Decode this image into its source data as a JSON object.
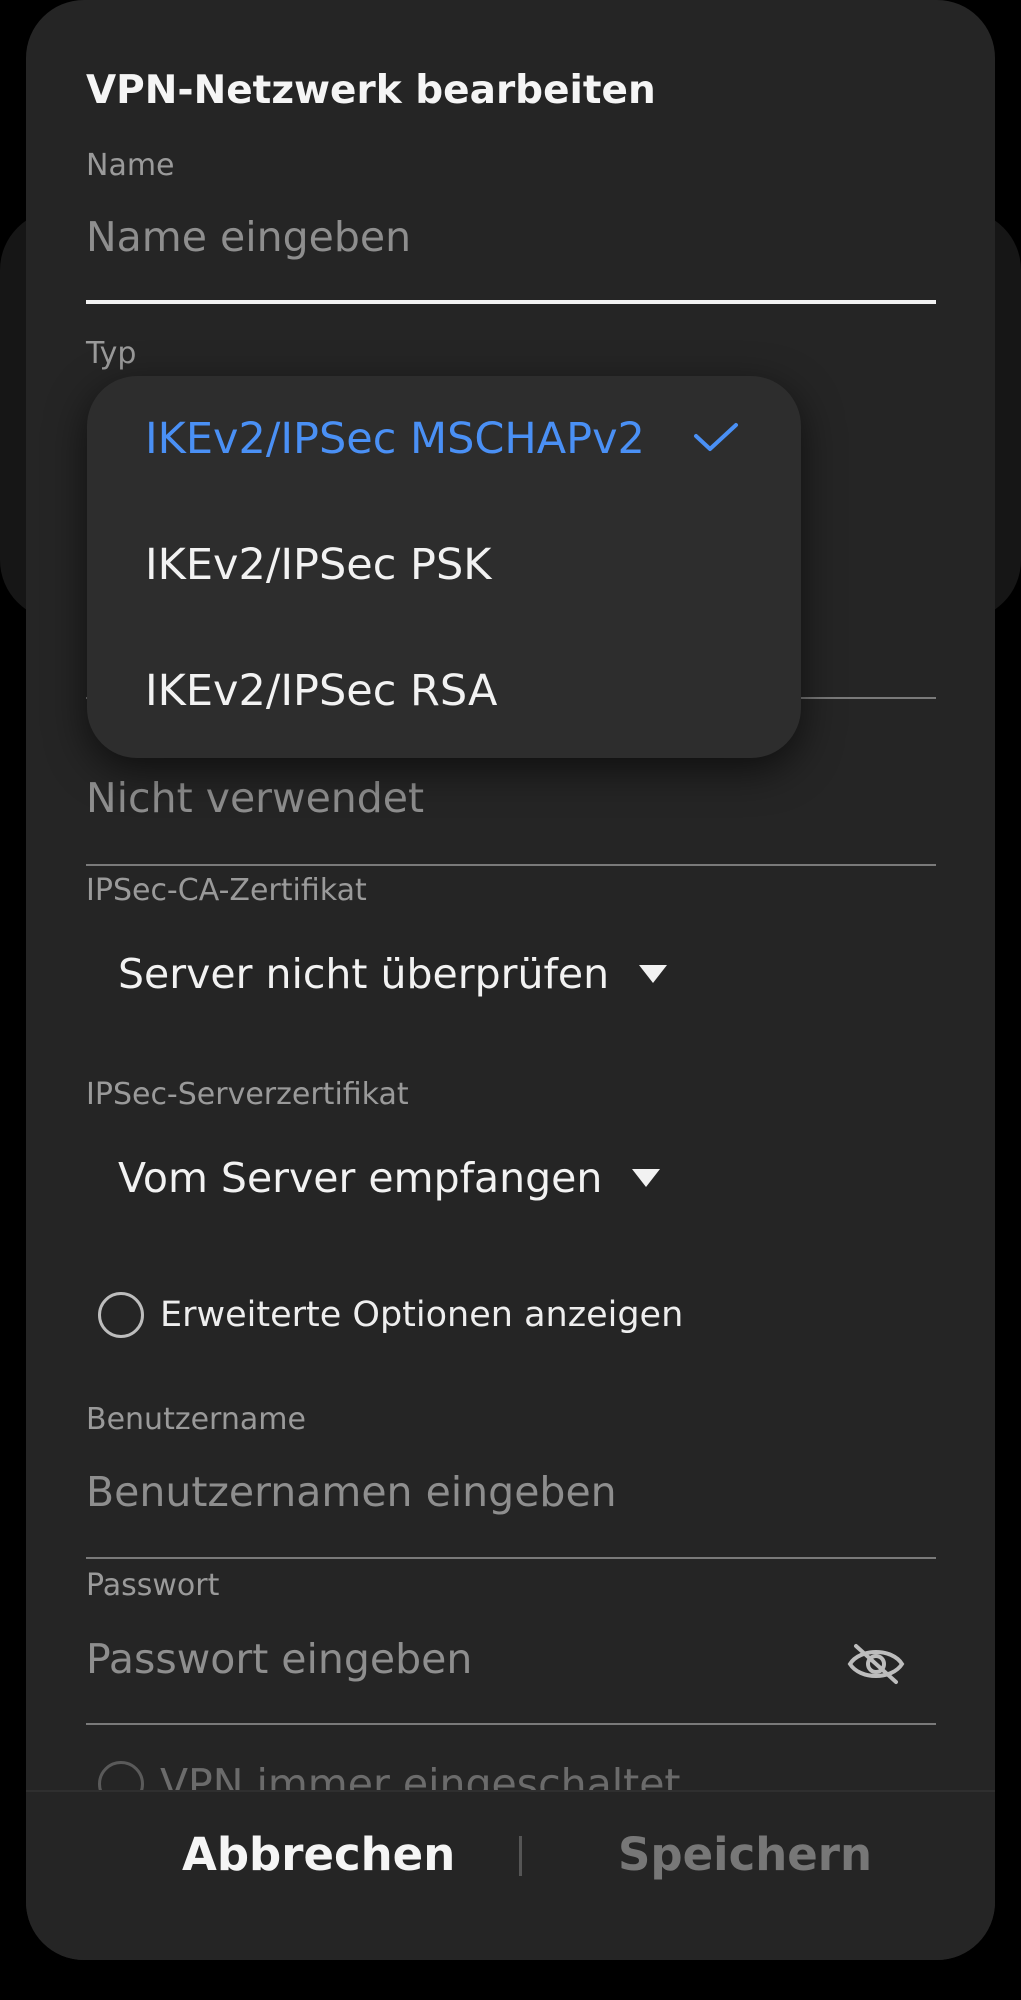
{
  "dialog": {
    "title": "VPN-Netzwerk bearbeiten",
    "name_label": "Name",
    "name_placeholder": "Name eingeben",
    "type_label": "Typ",
    "identifier_placeholder": "Nicht verwendet",
    "ca_cert_label": "IPSec-CA-Zertifikat",
    "ca_cert_value": "Server nicht überprüfen",
    "server_cert_label": "IPSec-Serverzertifikat",
    "server_cert_value": "Vom Server empfangen",
    "advanced_options_label": "Erweiterte Optionen anzeigen",
    "username_label": "Benutzername",
    "username_placeholder": "Benutzernamen eingeben",
    "password_label": "Passwort",
    "password_placeholder": "Passwort eingeben",
    "always_on_label": "VPN immer eingeschaltet",
    "cancel_label": "Abbrechen",
    "save_label": "Speichern"
  },
  "type_dropdown": {
    "options": [
      {
        "label": "IKEv2/IPSec MSCHAPv2",
        "selected": true
      },
      {
        "label": "IKEv2/IPSec PSK",
        "selected": false
      },
      {
        "label": "IKEv2/IPSec RSA",
        "selected": false
      }
    ]
  },
  "colors": {
    "accent": "#4a90f5",
    "dialog_bg": "#252525",
    "menu_bg": "#2d2d2d",
    "text_primary": "#f2f2f2",
    "text_secondary": "#9a9a9a",
    "disabled": "#777777"
  },
  "icons": {
    "check": "check-icon",
    "caret": "caret-down-icon",
    "password_visibility": "eye-off-icon"
  }
}
